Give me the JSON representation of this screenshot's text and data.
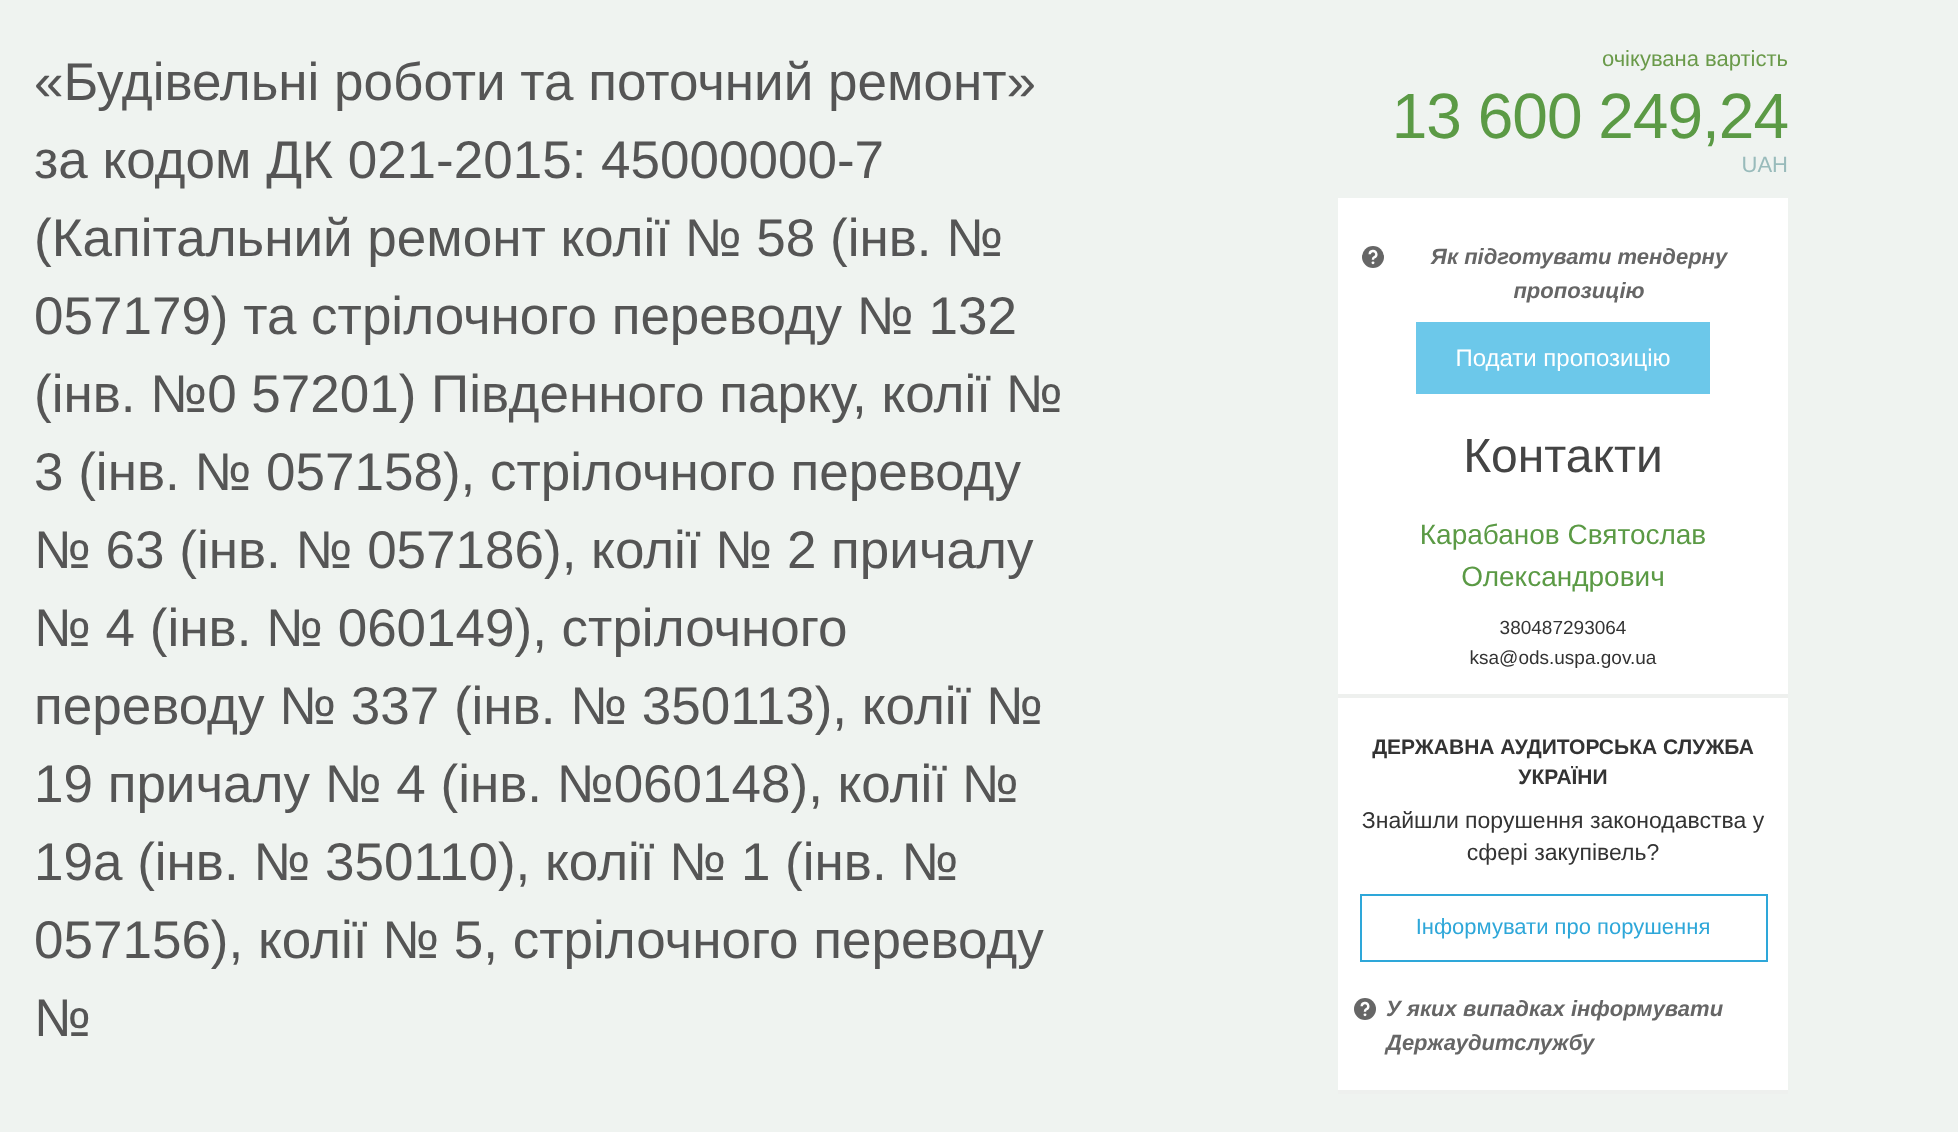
{
  "title": "«Будівельні роботи та поточний ремонт» за кодом ДК 021-2015: 45000000-7 (Капітальний ремонт колії № 58 (інв. № 057179) та стрілочного переводу № 132 (інв. №0 57201) Південного парку, колії № 3 (інв. № 057158), стрілочного переводу № 63 (інв. № 057186), колії № 2 причалу № 4 (інв. № 060149), стрілочного переводу № 337 (інв. № 350113), колії № 19 причалу № 4 (інв. №060148), колії № 19а (інв. № 350110), колії № 1 (інв. № 057156), колії № 5, стрілочного переводу №",
  "price": {
    "label": "очікувана вартість",
    "amount": "13 600 249,24",
    "currency": "UAH"
  },
  "help_link": "Як підготувати тендерну пропозицію",
  "submit_button": "Подати пропозицію",
  "contacts": {
    "heading": "Контакти",
    "name": "Карабанов Святослав Олександрович",
    "phone": "380487293064",
    "email": "ksa@ods.uspa.gov.ua"
  },
  "audit": {
    "heading": "ДЕРЖАВНА АУДИТОРСЬКА СЛУЖБА УКРАЇНИ",
    "question": "Знайшли порушення законодавства у сфері закупівель?",
    "button": "Інформувати про порушення",
    "help_link": "У яких випадках інформувати Держаудитслужбу"
  }
}
